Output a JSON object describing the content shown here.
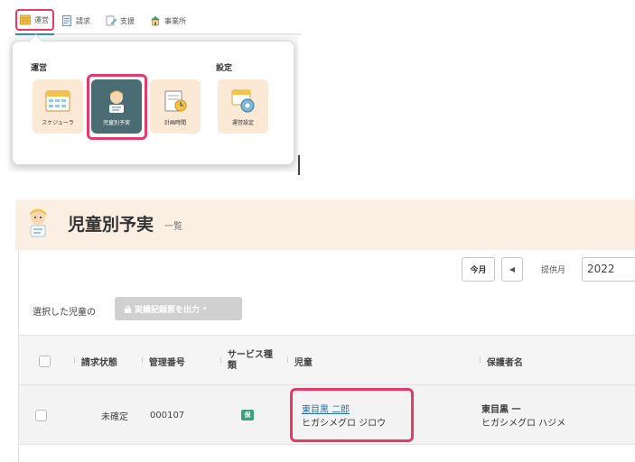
{
  "nav": {
    "items": [
      {
        "label": "運営",
        "icon": "calendar-grid-icon"
      },
      {
        "label": "請求",
        "icon": "invoice-icon"
      },
      {
        "label": "支援",
        "icon": "support-icon"
      },
      {
        "label": "事業所",
        "icon": "building-icon"
      }
    ]
  },
  "dropdown": {
    "sections": [
      {
        "title": "運営",
        "tiles": [
          {
            "label": "スケジューラ",
            "icon": "scheduler-icon"
          },
          {
            "label": "児童別予実",
            "icon": "child-plan-icon",
            "selected": true
          },
          {
            "label": "計画時間",
            "icon": "plan-time-icon"
          }
        ]
      },
      {
        "title": "設定",
        "tiles": [
          {
            "label": "運営設定",
            "icon": "settings-gear-icon"
          }
        ]
      }
    ]
  },
  "page": {
    "title": "児童別予実",
    "subtitle": "一覧"
  },
  "toolbar": {
    "today_label": "今月",
    "prev_label": "◀",
    "month_label": "提供月",
    "month_value": "2022"
  },
  "actions": {
    "selected_label": "選択した児童の",
    "export_label": "実績記録票を出力"
  },
  "table": {
    "headers": [
      "請求状態",
      "管理番号",
      "サービス種類",
      "児童",
      "保護者名"
    ],
    "rows": [
      {
        "status": "未確定",
        "number": "000107",
        "service": "保",
        "child_name": "東目黒 二郎",
        "child_kana": "ヒガシメグロ ジロウ",
        "guardian_name": "東目黒 一",
        "guardian_kana": "ヒガシメグロ ハジメ"
      }
    ]
  },
  "colors": {
    "highlight": "#e63b6a",
    "header_bg": "#fbeee3",
    "tile_bg": "#fbe8d5",
    "tile_selected": "#4a6d74",
    "badge": "#3aa07a"
  }
}
